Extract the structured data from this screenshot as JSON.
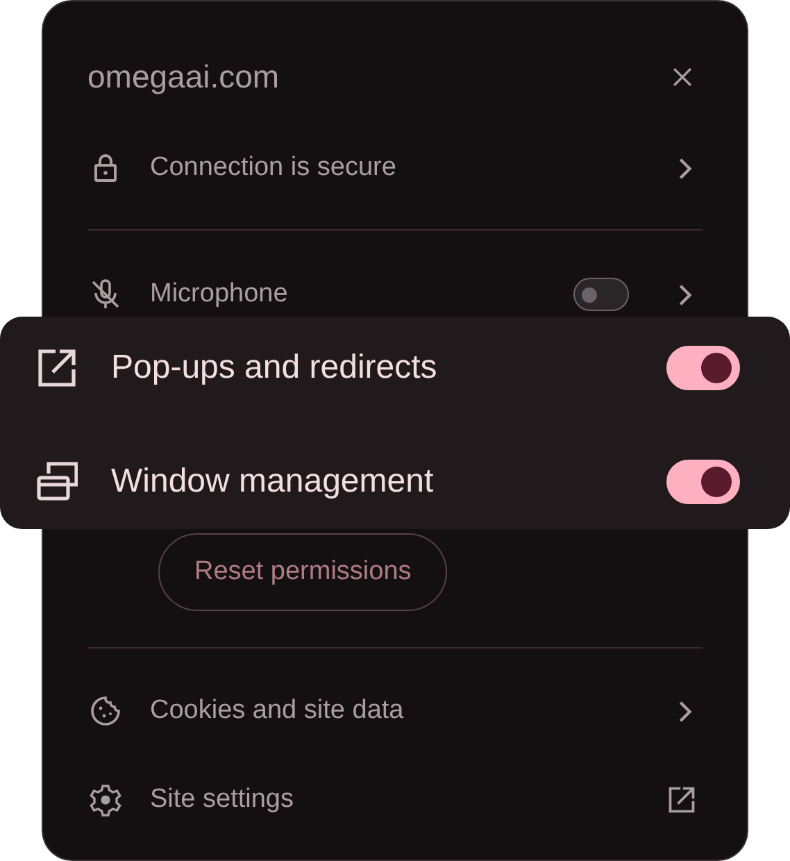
{
  "site": {
    "title": "omegaai.com"
  },
  "connection": {
    "label": "Connection is secure"
  },
  "microphone": {
    "label": "Microphone",
    "on": false
  },
  "permissions": [
    {
      "label": "Pop-ups and redirects",
      "on": true
    },
    {
      "label": "Window management",
      "on": true
    }
  ],
  "reset_button": {
    "label": "Reset permissions"
  },
  "cookies": {
    "label": "Cookies and site data"
  },
  "site_settings": {
    "label": "Site settings"
  }
}
